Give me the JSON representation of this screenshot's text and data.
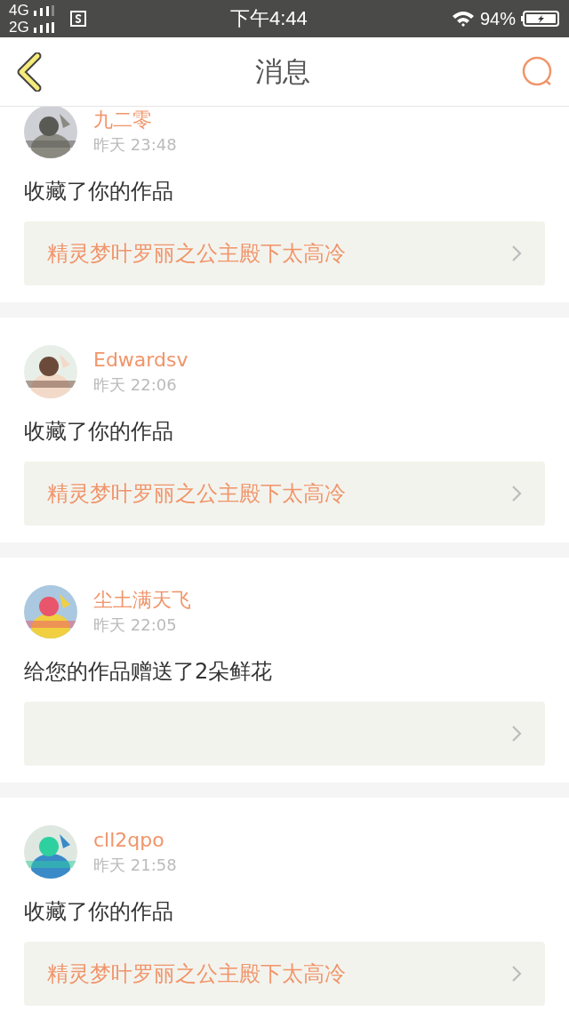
{
  "status_bar": {
    "network_1": "4G",
    "network_2": "2G",
    "time": "下午4:44",
    "battery": "94%"
  },
  "header": {
    "title": "消息"
  },
  "messages": [
    {
      "name": "九二零",
      "time": "昨天 23:48",
      "action": "收藏了你的作品",
      "work": "精灵梦叶罗丽之公主殿下太高冷"
    },
    {
      "name": "Edwardsv",
      "time": "昨天 22:06",
      "action": "收藏了你的作品",
      "work": "精灵梦叶罗丽之公主殿下太高冷"
    },
    {
      "name": "尘土满天飞",
      "time": "昨天 22:05",
      "action": "给您的作品赠送了2朵鲜花"
    },
    {
      "name": "cll2qpo",
      "time": "昨天 21:58",
      "action": "收藏了你的作品",
      "work": "精灵梦叶罗丽之公主殿下太高冷"
    }
  ]
}
